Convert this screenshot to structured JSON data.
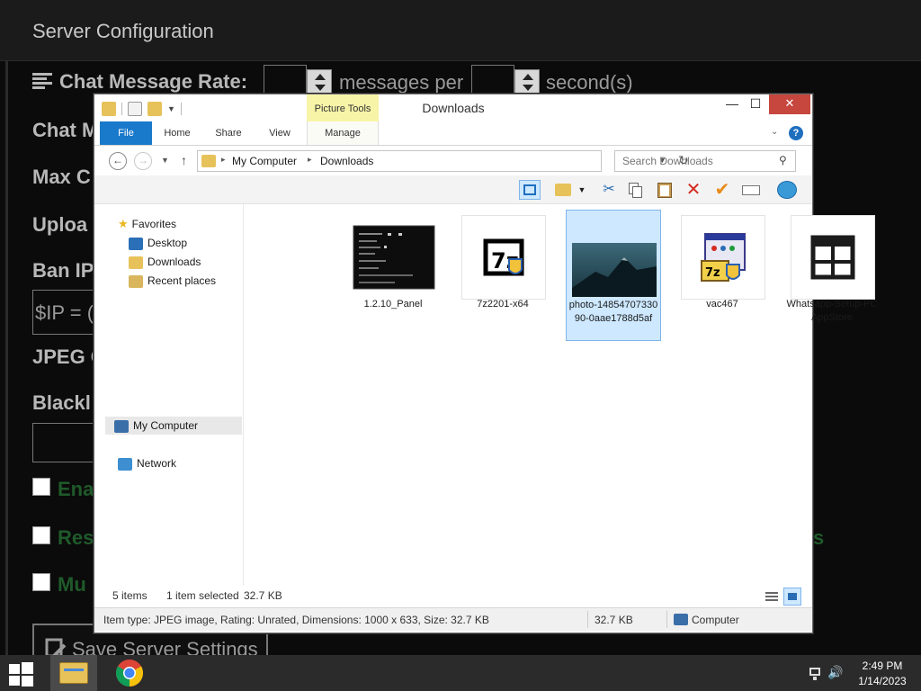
{
  "background_app": {
    "title": "Server Configuration",
    "labels": {
      "chat_rate": "Chat Message Rate:",
      "messages_per": "messages per",
      "seconds": "second(s)",
      "chat_m": "Chat M",
      "max_c": "Max C",
      "uploa": "Uploa",
      "ban_ip": "Ban IP",
      "ip_field": "$IP = (",
      "jpeg": "JPEG C",
      "blackl": "Blackl",
      "check1": "Ena",
      "check2": "Res",
      "check2_tail": "s",
      "check3": "Mu"
    },
    "save_label": "Save Server Settings"
  },
  "explorer": {
    "window_title": "Downloads",
    "context_tab": "Picture Tools",
    "tabs": {
      "file": "File",
      "home": "Home",
      "share": "Share",
      "view": "View",
      "manage": "Manage"
    },
    "window_controls": {
      "minimize": "—",
      "maximize": "☐",
      "close": "✕"
    },
    "address": {
      "crumbs": [
        "My Computer",
        "Downloads"
      ]
    },
    "search": {
      "placeholder": "Search Downloads"
    },
    "nav": {
      "favorites": "Favorites",
      "desktop": "Desktop",
      "downloads": "Downloads",
      "recent": "Recent places",
      "mycomputer": "My Computer",
      "network": "Network"
    },
    "files": [
      {
        "name": "1.2.10_Panel",
        "type": "screenshot-thumb",
        "selected": false
      },
      {
        "name": "7z2201-x64",
        "type": "7zip-installer-icon",
        "selected": false
      },
      {
        "name": "photo-1485470733090-0aae1788d5af",
        "type": "mountain-photo-thumb",
        "selected": true
      },
      {
        "name": "vac467",
        "type": "setup-installer-icon",
        "selected": false
      },
      {
        "name": "Whatsapp-Setup-PCAppStore",
        "type": "window-grid-icon",
        "selected": false
      }
    ],
    "status": {
      "items": "5 items",
      "selected": "1 item selected",
      "size": "32.7 KB"
    },
    "details": {
      "info": "Item type: JPEG image, Rating: Unrated, Dimensions: 1000 x 633, Size: 32.7 KB",
      "size": "32.7 KB",
      "location": "Computer"
    }
  },
  "taskbar": {
    "time": "2:49 PM",
    "date": "1/14/2023"
  },
  "colors": {
    "accent": "#1979ca",
    "selection": "#cde8ff",
    "context_tab": "#f7f4a8",
    "close_button": "#c7463e"
  }
}
